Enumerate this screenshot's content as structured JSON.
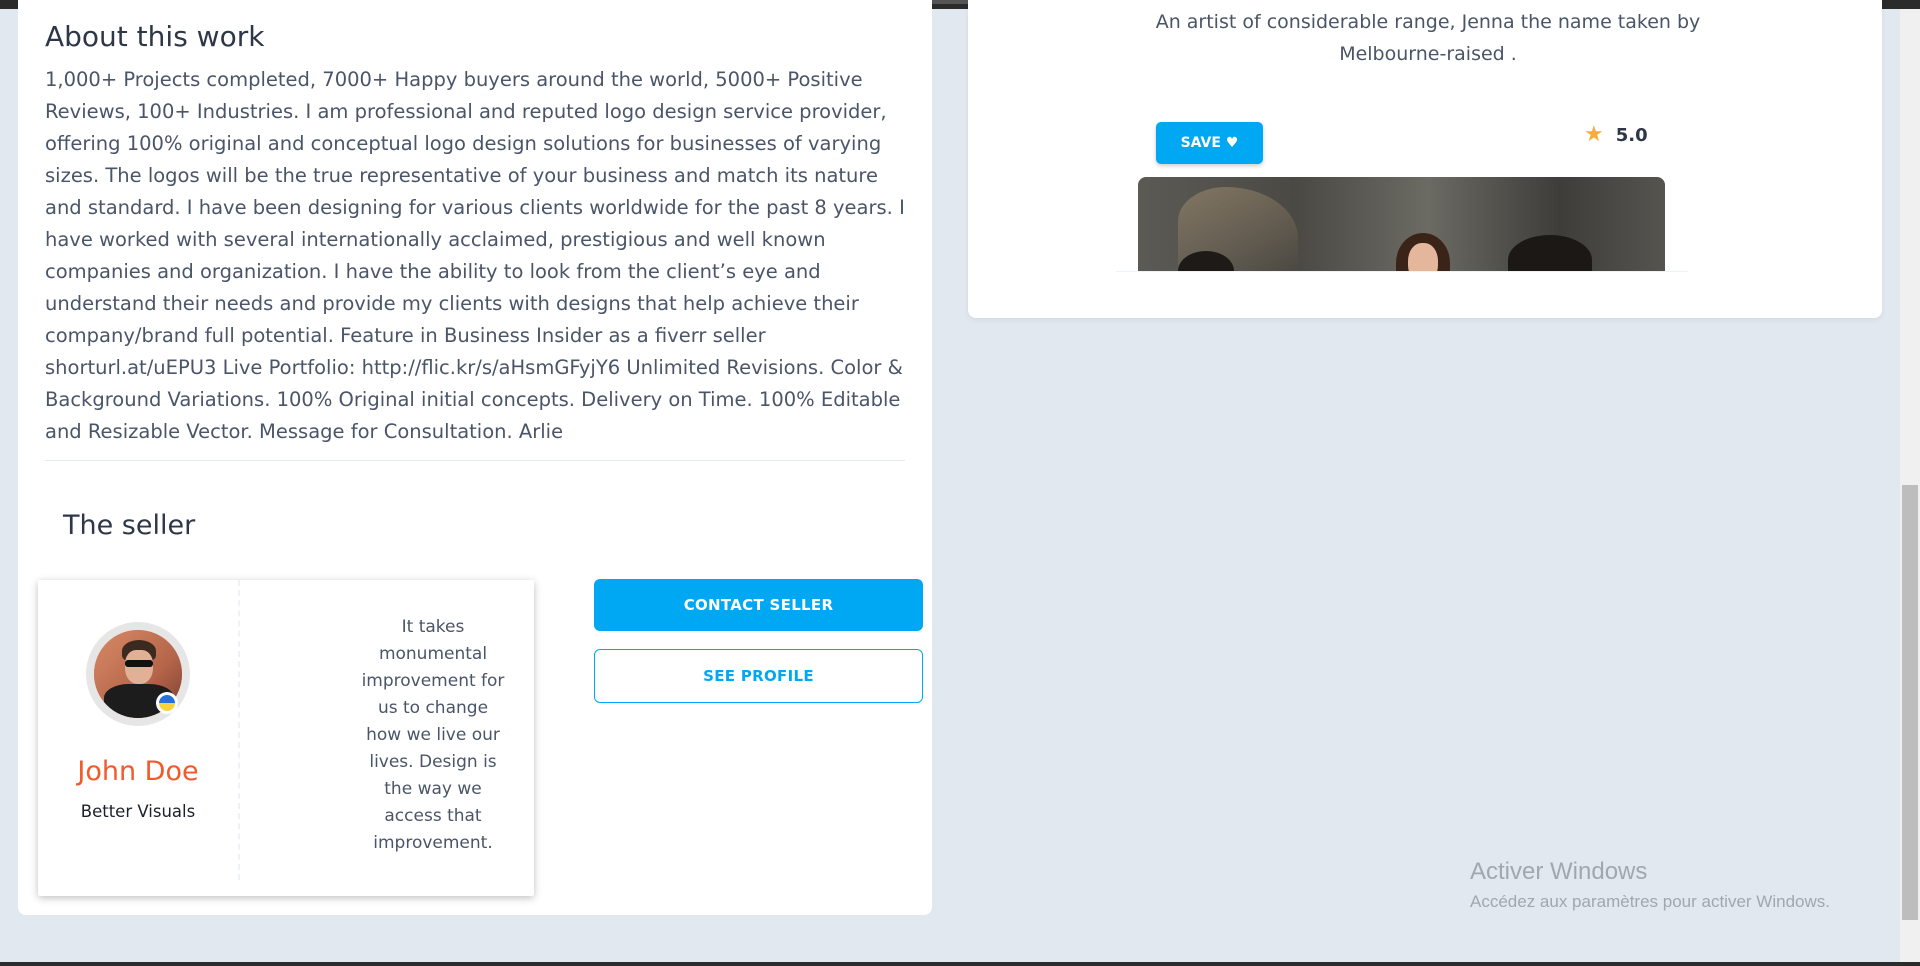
{
  "about": {
    "title": "About this work",
    "description": "1,000+ Projects completed, 7000+ Happy buyers around the world, 5000+ Positive Reviews, 100+ Industries. I am professional and reputed logo design service provider, offering 100% original and conceptual logo design solutions for businesses of varying sizes. The logos will be the true representative of your business and match its nature and standard. I have been designing for various clients worldwide for the past 8 years. I have worked with several internationally acclaimed, prestigious and well known companies and organization. I have the ability to look from the client’s eye and understand their needs and provide my clients with designs that help achieve their company/brand full potential. Feature in Business Insider as a fiverr seller shorturl.at/uEPU3 Live Portfolio: http://flic.kr/s/aHsmGFyjY6 Unlimited Revisions. Color & Background Variations. 100% Original initial concepts. Delivery on Time. 100% Editable and Resizable Vector. Message for Consultation. Arlie"
  },
  "seller": {
    "section_title": "The seller",
    "name": "John Doe",
    "company": "Better Visuals",
    "quote": "It takes monumental improvement for us to change how we live our lives. Design is the way we access that improvement.",
    "contact_label": "CONTACT SELLER",
    "profile_label": "SEE PROFILE"
  },
  "artist_card": {
    "description": "An artist of considerable range, Jenna the name taken by Melbourne-raised .",
    "save_label": "SAVE ♥",
    "rating": "5.0",
    "star_glyph": "★"
  },
  "watermark": {
    "title": "Activer Windows",
    "subtitle": "Accédez aux paramètres pour activer Windows."
  },
  "colors": {
    "accent": "#00a8f3",
    "seller_name": "#f25a2a",
    "star": "#f6ad3b",
    "page_bg": "#e2e8f0"
  }
}
